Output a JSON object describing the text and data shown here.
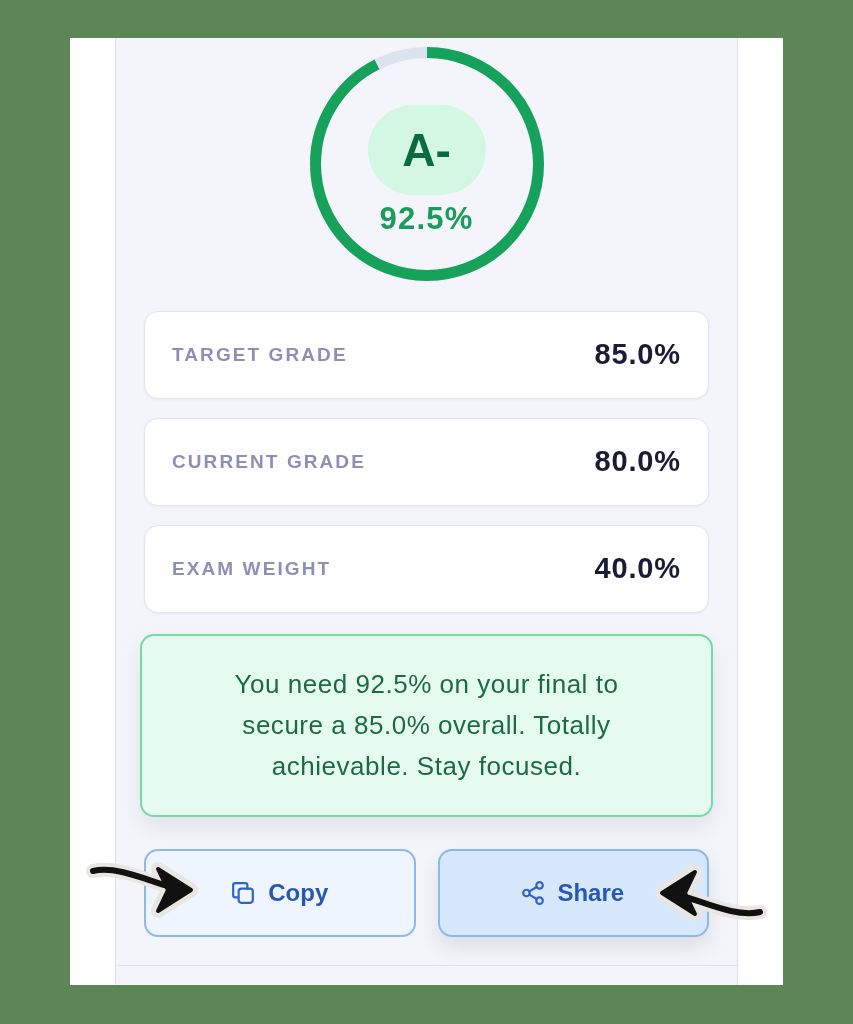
{
  "gauge": {
    "grade": "A-",
    "score": "92.5%",
    "level": 0.925
  },
  "stats": [
    {
      "label": "TARGET GRADE",
      "value": "85.0%"
    },
    {
      "label": "CURRENT GRADE",
      "value": "80.0%"
    },
    {
      "label": "EXAM WEIGHT",
      "value": "40.0%"
    }
  ],
  "message": "You need 92.5% on your final to secure a 85.0% overall. Totally achievable. Stay focused.",
  "actions": [
    {
      "kind": "copy",
      "label": "Copy",
      "highlighted": false,
      "pointed_at": true
    },
    {
      "kind": "share",
      "label": "Share",
      "highlighted": true,
      "pointed_at": true
    }
  ]
}
